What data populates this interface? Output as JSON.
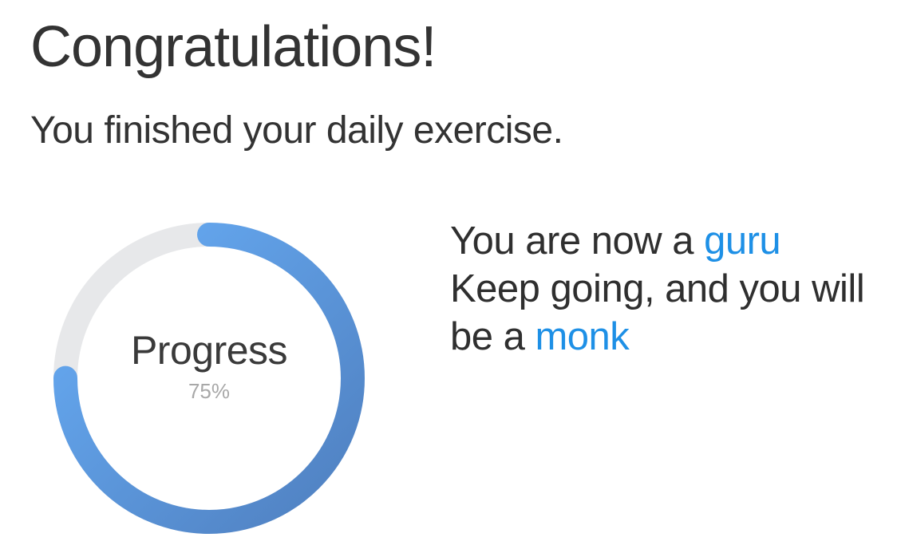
{
  "header": {
    "title": "Congratulations!",
    "subtitle": "You finished your daily exercise."
  },
  "progress": {
    "label": "Progress",
    "value_text": "75%",
    "fraction": 0.75,
    "track_color": "#e7e8ea",
    "gradient_start": "#68aef7",
    "gradient_end": "#4f7fbf"
  },
  "message": {
    "line1_prefix": "You are now a ",
    "line1_highlight": "guru",
    "line2": "Keep going, and you will",
    "line3_prefix": "be a ",
    "line3_highlight": "monk",
    "highlight_color": "#1e90e6"
  }
}
